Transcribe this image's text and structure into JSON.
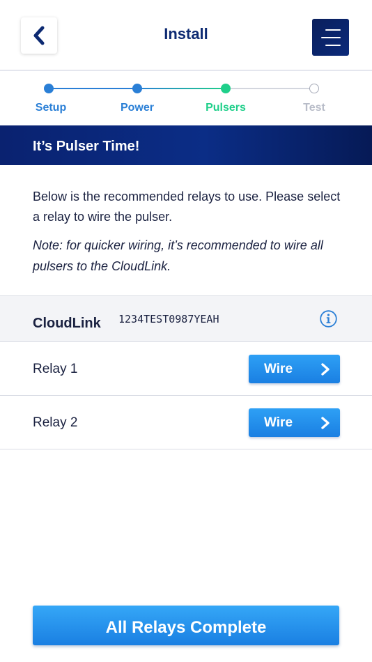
{
  "header": {
    "title": "Install",
    "back_icon": "chevron-left-icon",
    "menu_icon": "hamburger-menu-icon"
  },
  "stepper": {
    "steps": [
      {
        "label": "Setup",
        "state": "complete"
      },
      {
        "label": "Power",
        "state": "complete"
      },
      {
        "label": "Pulsers",
        "state": "active"
      },
      {
        "label": "Test",
        "state": "pending"
      }
    ]
  },
  "banner": {
    "title": "It’s Pulser Time!"
  },
  "content": {
    "description": "Below is the recommended relays to use. Please select a relay to wire the pulser.",
    "note": "Note: for quicker wiring, it’s recommended to wire all pulsers to the CloudLink."
  },
  "cloudlink": {
    "name": "CloudLink",
    "serial": "1234TEST0987YEAH",
    "info_icon": "info-circle-icon"
  },
  "relays": [
    {
      "label": "Relay 1",
      "button_label": "Wire"
    },
    {
      "label": "Relay 2",
      "button_label": "Wire"
    }
  ],
  "footer": {
    "complete_label": "All Relays Complete"
  },
  "colors": {
    "navy": "#0d2a72",
    "blue": "#2a7fd6",
    "green": "#1fcf8a",
    "gray": "#b8bcc8",
    "button_blue": "#1a7fe2"
  }
}
